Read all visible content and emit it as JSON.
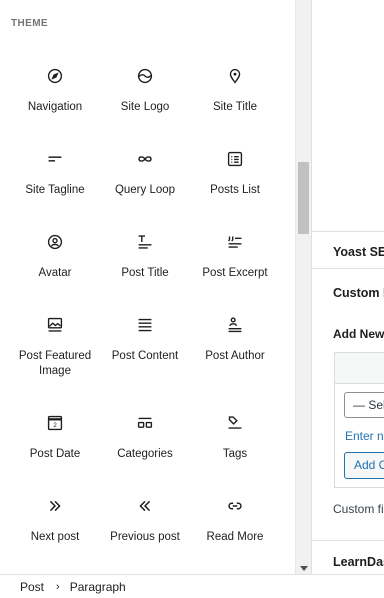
{
  "inserter": {
    "section_title": "THEME",
    "blocks": [
      {
        "label": "Navigation",
        "icon": "compass-icon"
      },
      {
        "label": "Site Logo",
        "icon": "site-logo-icon"
      },
      {
        "label": "Site Title",
        "icon": "map-marker-icon"
      },
      {
        "label": "Site Tagline",
        "icon": "tagline-icon"
      },
      {
        "label": "Query Loop",
        "icon": "loop-icon"
      },
      {
        "label": "Posts List",
        "icon": "posts-list-icon"
      },
      {
        "label": "Avatar",
        "icon": "avatar-icon"
      },
      {
        "label": "Post Title",
        "icon": "post-title-icon"
      },
      {
        "label": "Post Excerpt",
        "icon": "post-excerpt-icon"
      },
      {
        "label": "Post Featured Image",
        "icon": "featured-image-icon"
      },
      {
        "label": "Post Content",
        "icon": "post-content-icon"
      },
      {
        "label": "Post Author",
        "icon": "post-author-icon"
      },
      {
        "label": "Post Date",
        "icon": "calendar-icon"
      },
      {
        "label": "Categories",
        "icon": "categories-icon"
      },
      {
        "label": "Tags",
        "icon": "tag-icon"
      },
      {
        "label": "Next post",
        "icon": "chevrons-right-icon"
      },
      {
        "label": "Previous post",
        "icon": "chevrons-left-icon"
      },
      {
        "label": "Read More",
        "icon": "link-icon"
      }
    ]
  },
  "settings": {
    "yoast_heading": "Yoast SEO",
    "custom_fields_heading": "Custom Fields",
    "add_new_label": "Add New Custom Field:",
    "select_value": "— Select —",
    "enter_new_link": "Enter new",
    "add_button": "Add Custom Field",
    "custom_fields_note": "Custom fields can be used to add extra metadata to a post",
    "learndash_heading": "LearnDash"
  },
  "footer": {
    "crumb_post": "Post",
    "crumb_paragraph": "Paragraph"
  }
}
